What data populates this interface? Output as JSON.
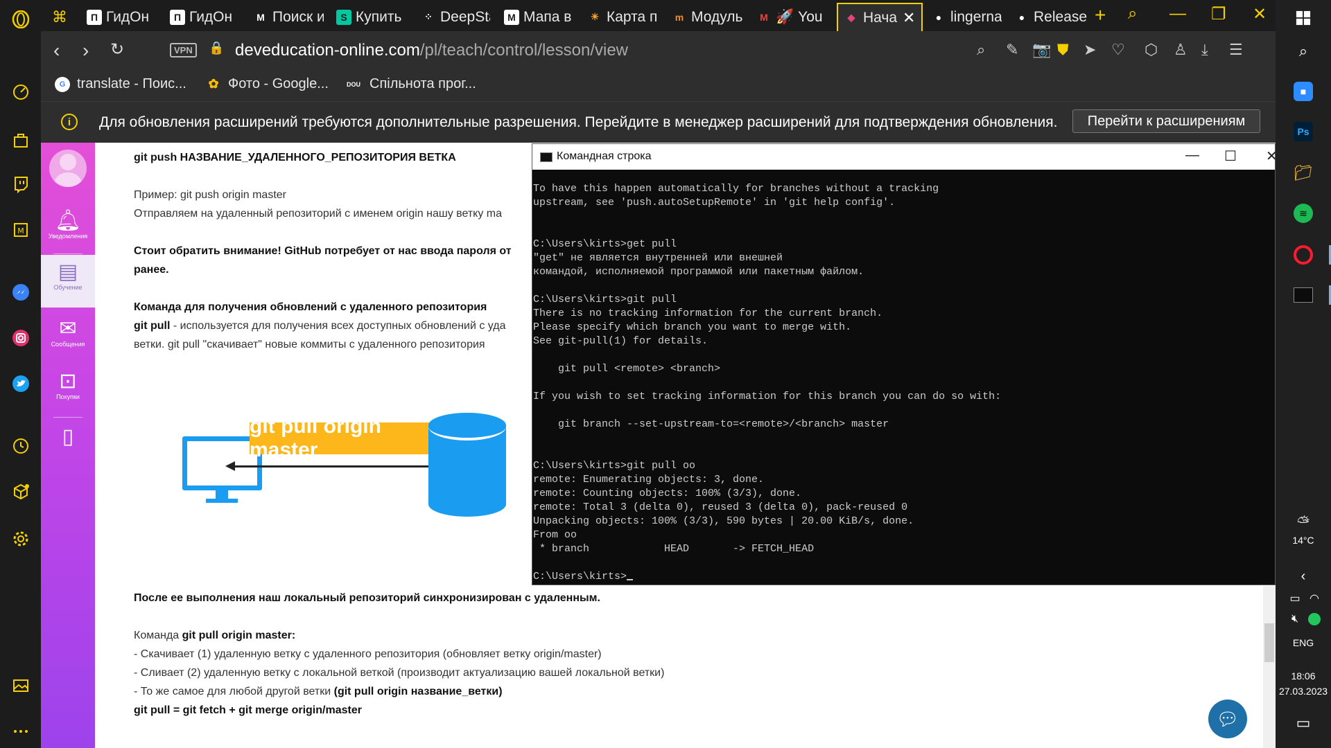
{
  "browser": {
    "tabs": [
      {
        "label": "ГидОнл",
        "favicon": "П",
        "fav_color": "#ffffff",
        "fav_bg": "#1c1c1c"
      },
      {
        "label": "ГидОнл",
        "favicon": "П",
        "fav_color": "#ffffff",
        "fav_bg": "#1c1c1c"
      },
      {
        "label": "Поиск и",
        "favicon": "М",
        "fav_color": "#ffffff",
        "fav_bg": "#1c1c1c"
      },
      {
        "label": "Купить",
        "favicon": "S",
        "fav_color": "#1c1c1c",
        "fav_bg": "#00c8a0"
      },
      {
        "label": "DeepSta",
        "favicon": "⁘",
        "fav_color": "#ffffff",
        "fav_bg": "#1c1c1c"
      },
      {
        "label": "Мапа в",
        "favicon": "M",
        "fav_color": "#1c1c1c",
        "fav_bg": "#ffffff"
      },
      {
        "label": "Карта п",
        "favicon": "☀",
        "fav_color": "#f5a623",
        "fav_bg": "#1c1c1c"
      },
      {
        "label": "Модуль",
        "favicon": "m",
        "fav_color": "#f28c28",
        "fav_bg": "#1c1c1c"
      },
      {
        "label": "You",
        "favicon": "M",
        "fav_color": "#ea4335",
        "fav_bg": "#1c1c1c"
      },
      {
        "label": "Нача",
        "favicon": "◆",
        "fav_color": "#e0457b",
        "fav_bg": "#1c1c1c",
        "active": true
      },
      {
        "label": "lingerna",
        "favicon": "●",
        "fav_color": "#ffffff",
        "fav_bg": "#1c1c1c"
      },
      {
        "label": "Release",
        "favicon": "●",
        "fav_color": "#ffffff",
        "fav_bg": "#1c1c1c"
      }
    ],
    "url_host": "deveducation-online.com",
    "url_path": "/pl/teach/control/lesson/view",
    "vpn_label": "VPN",
    "bookmarks": [
      {
        "label": "translate - Поис...",
        "icon": "G",
        "icon_bg": "#ffffff",
        "icon_color": "#4285f4"
      },
      {
        "label": "Фото - Google...",
        "icon": "✿",
        "icon_bg": "#2e2e2e",
        "icon_color": "#fbbc05"
      },
      {
        "label": "Спільнота прог...",
        "icon": "DOU",
        "icon_bg": "#2e2e2e",
        "icon_color": "#ffffff"
      }
    ],
    "notice_text": "Для обновления расширений требуются дополнительные разрешения. Перейдите в менеджер расширений для подтверждения обновления.",
    "notice_button": "Перейти к расширениям"
  },
  "site_sidebar": {
    "items": [
      {
        "label": "Уведомления",
        "icon": "bell-icon"
      },
      {
        "label": "Обучение",
        "icon": "book-icon",
        "active": true
      },
      {
        "label": "Сообщения",
        "icon": "mail-icon"
      },
      {
        "label": "Покупки",
        "icon": "ticket-icon"
      },
      {
        "label": "",
        "icon": "phone-icon"
      }
    ]
  },
  "lesson": {
    "p1": "git push НАЗВАНИЕ_УДАЛЕННОГО_РЕПОЗИТОРИЯ ВЕТКА",
    "p2": "Пример: git push origin master",
    "p3": "Отправляем на удаленный репозиторий с именем origin нашу ветку ma",
    "p4": "Стоит обратить внимание! GitHub потребует от нас ввода пароля от",
    "p5": "ранее.",
    "p6": "Команда для получения обновлений с удаленного репозитория",
    "p7_bold": "git pull",
    "p7_rest": " - используется для получения всех доступных обновлений с уда",
    "p8": "ветки. git pull \"скачивает\" новые коммиты с удаленного репозитория",
    "diagram_label": "git pull origin master",
    "p9": "После ее выполнения наш локальный репозиторий синхронизирован с удаленным.",
    "p10_plain": "Команда ",
    "p10_bold": "git pull origin master:",
    "p11": "- Скачивает (1) удаленную ветку с удаленного репозитория (обновляет ветку origin/master)",
    "p12": "- Сливает (2) удаленную ветку с локальной веткой (производит актуализацию вашей локальной ветки)",
    "p13_plain": "- То же самое для любой другой ветки ",
    "p13_bold": "(git pull origin название_ветки)",
    "p14": "git pull = git fetch + git merge origin/master"
  },
  "cmd": {
    "title": "Командная строка",
    "output": "To have this happen automatically for branches without a tracking\nupstream, see 'push.autoSetupRemote' in 'git help config'.\n\n\nC:\\Users\\kirts>get pull\n\"get\" не является внутренней или внешней\nкомандой, исполняемой программой или пакетным файлом.\n\nC:\\Users\\kirts>git pull\nThere is no tracking information for the current branch.\nPlease specify which branch you want to merge with.\nSee git-pull(1) for details.\n\n    git pull <remote> <branch>\n\nIf you wish to set tracking information for this branch you can do so with:\n\n    git branch --set-upstream-to=<remote>/<branch> master\n\n\nC:\\Users\\kirts>git pull oo\nremote: Enumerating objects: 3, done.\nremote: Counting objects: 100% (3/3), done.\nremote: Total 3 (delta 0), reused 3 (delta 0), pack-reused 0\nUnpacking objects: 100% (3/3), 590 bytes | 20.00 KiB/s, done.\nFrom oo\n * branch            HEAD       -> FETCH_HEAD\n\nC:\\Users\\kirts>"
  },
  "taskbar": {
    "weather": "14°C",
    "lang": "ENG",
    "time": "18:06",
    "date": "27.03.2023"
  }
}
